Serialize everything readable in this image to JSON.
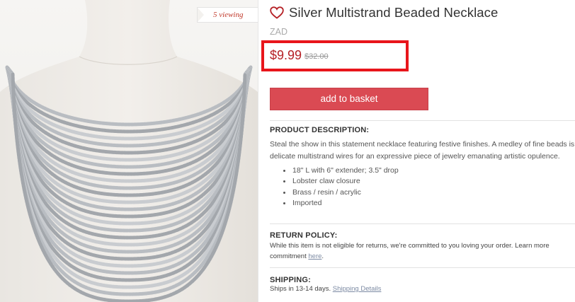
{
  "product": {
    "title": "Silver Multistrand Beaded Necklace",
    "brand": "ZAD",
    "viewing": "5 viewing",
    "sale_price": "$9.99",
    "original_price": "$32.00",
    "image_icon": "necklace-product-photo",
    "favorite_icon": "heart-outline-icon"
  },
  "actions": {
    "add_to_basket": "add to basket"
  },
  "description": {
    "heading": "PRODUCT DESCRIPTION:",
    "line1": "Steal the show in this statement necklace featuring festive finishes. A medley of fine beads is",
    "line2": "delicate multistrand wires for an expressive piece of jewelry emanating artistic opulence.",
    "bullets": [
      "18\" L with 6\" extender; 3.5\" drop",
      "Lobster claw closure",
      "Brass / resin / acrylic",
      "Imported"
    ]
  },
  "return_policy": {
    "heading": "RETURN POLICY:",
    "line1": "While this item is not eligible for returns, we're committed to you loving your order. Learn more",
    "line2_prefix": "commitment",
    "line2_link": "here",
    "line2_suffix": "."
  },
  "shipping": {
    "heading": "SHIPPING:",
    "text": "Ships in 13-14 days.",
    "link": "Shipping Details"
  },
  "colors": {
    "accent": "#da4a53",
    "price": "#b52025",
    "highlight_box": "#e8151b",
    "link": "#7c8aa3"
  }
}
